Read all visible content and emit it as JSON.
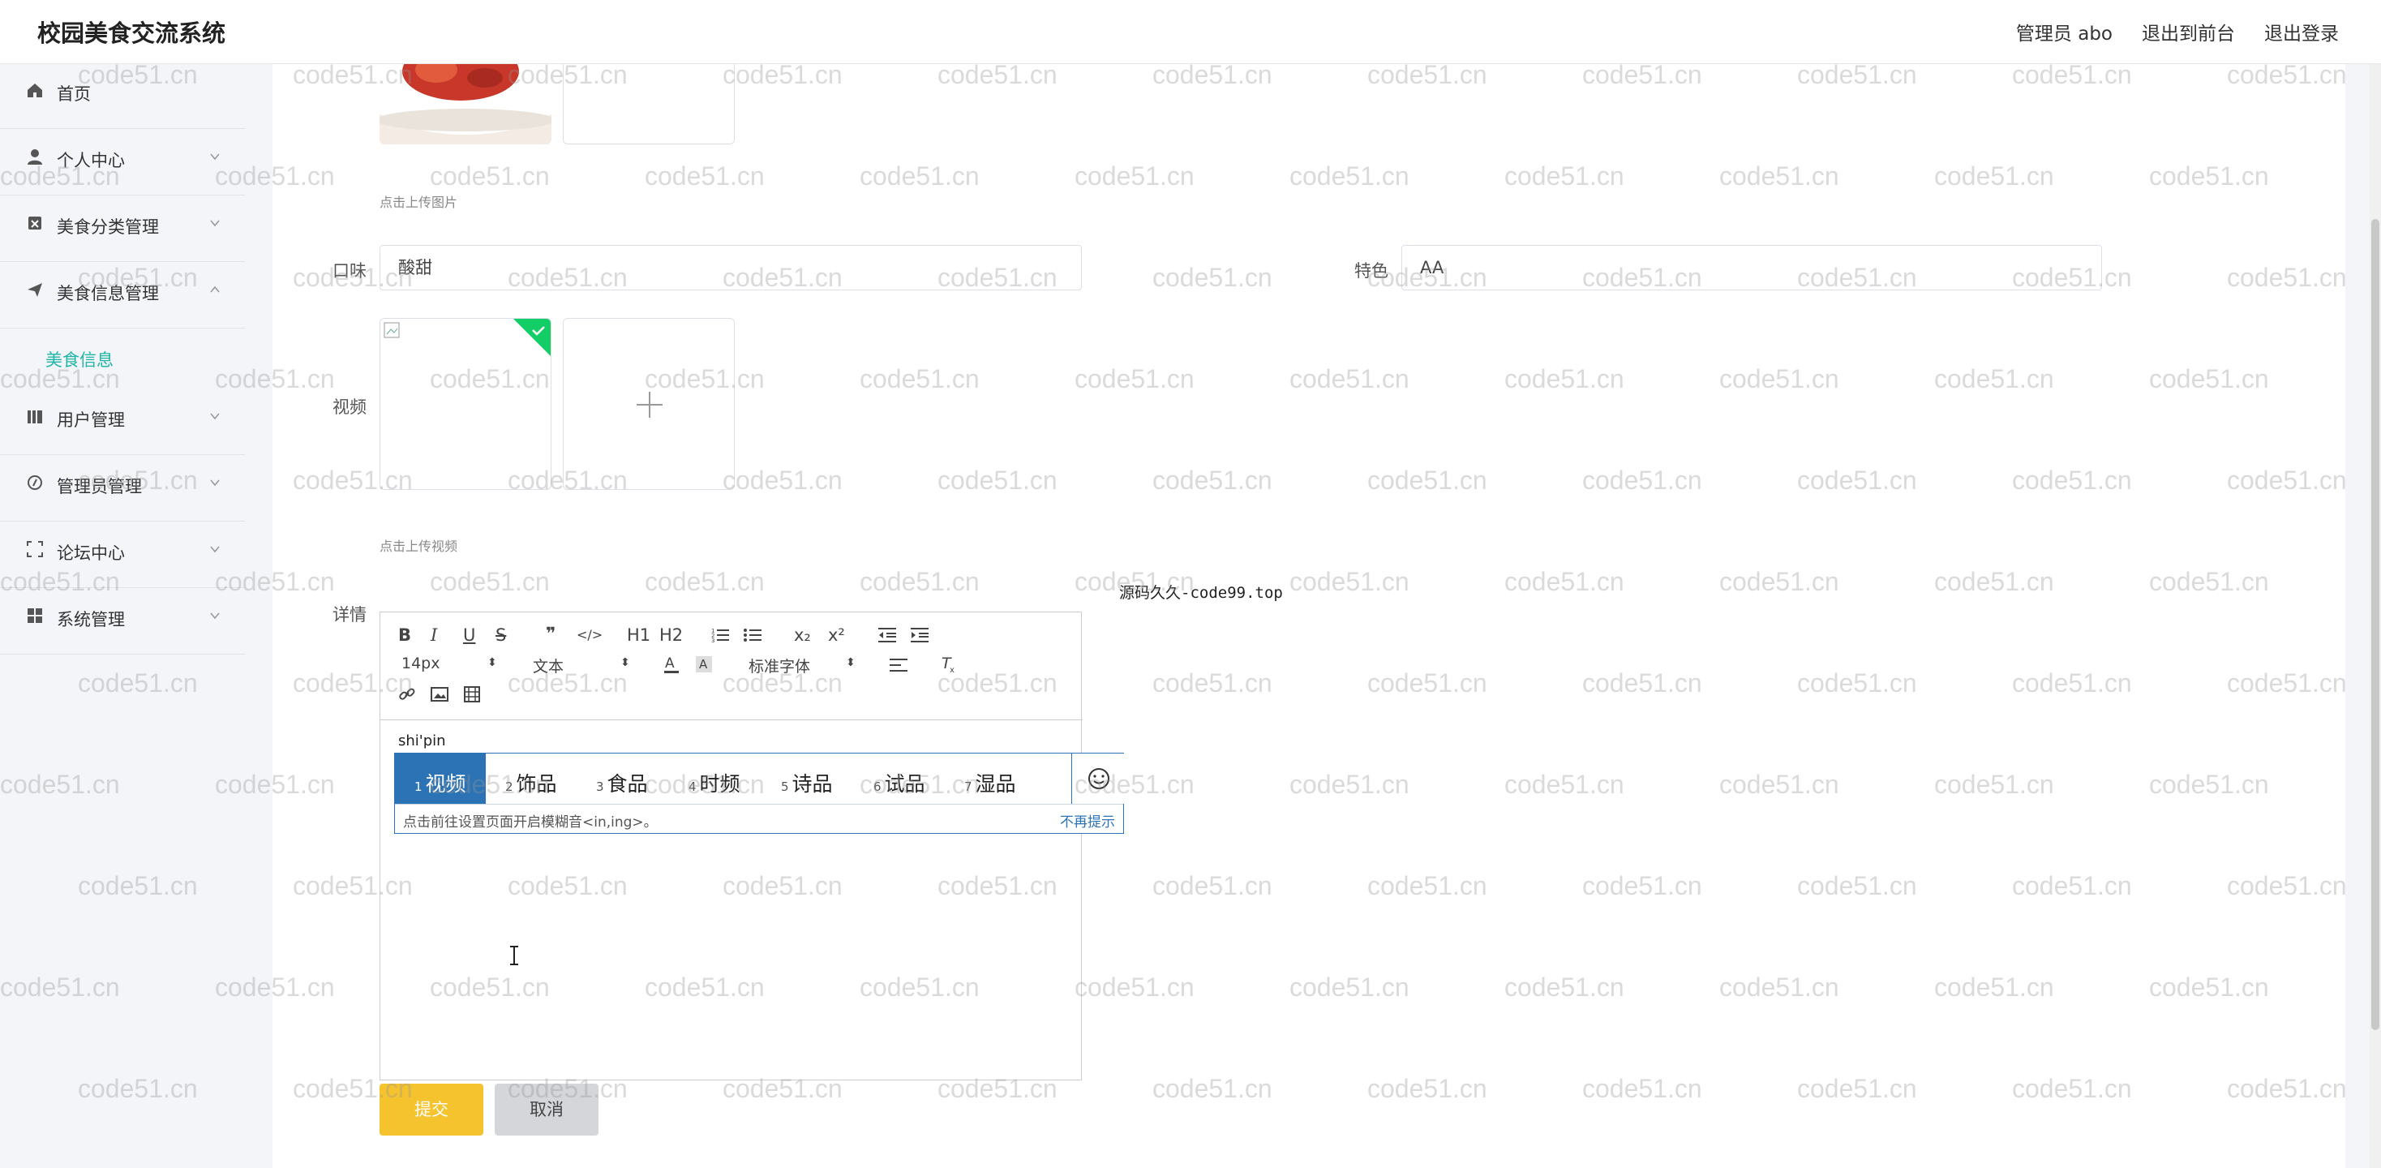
{
  "header": {
    "app_title": "校园美食交流系统",
    "user_label": "管理员 abo",
    "to_frontend": "退出到前台",
    "logout": "退出登录"
  },
  "sidebar": {
    "items": [
      {
        "label": "首页",
        "icon": "home-icon"
      },
      {
        "label": "个人中心",
        "icon": "user-icon"
      },
      {
        "label": "美食分类管理",
        "icon": "category-icon"
      },
      {
        "label": "美食信息管理",
        "icon": "send-icon"
      },
      {
        "label": "用户管理",
        "icon": "bars-icon"
      },
      {
        "label": "管理员管理",
        "icon": "compass-icon"
      },
      {
        "label": "论坛中心",
        "icon": "frame-icon"
      },
      {
        "label": "系统管理",
        "icon": "grid-icon"
      }
    ],
    "active_sub": "美食信息"
  },
  "form": {
    "image_hint": "点击上传图片",
    "taste_label": "口味",
    "taste_value": "酸甜",
    "feature_label": "特色",
    "feature_value": "AA",
    "video_label": "视频",
    "video_hint": "点击上传视频",
    "detail_label": "详情",
    "submit": "提交",
    "cancel": "取消"
  },
  "editor": {
    "font_size": "14px",
    "header_select": "文本",
    "font_family": "标准字体",
    "content": "shi'pin",
    "toolbar_buttons": [
      "B",
      "I",
      "U",
      "S",
      "❞",
      "</>",
      "H1",
      "H2",
      "ordered-list",
      "bullet-list",
      "x₂",
      "x²",
      "outdent",
      "indent",
      "font-color",
      "background",
      "align",
      "clean",
      "link",
      "image",
      "video"
    ]
  },
  "ime": {
    "candidates": [
      "视频",
      "饰品",
      "食品",
      "时频",
      "诗品",
      "试品",
      "湿品"
    ],
    "tip": "点击前往设置页面开启模糊音<in,ing>。",
    "dismiss": "不再提示"
  },
  "overlay_text": "源码久久-code99.top",
  "watermark": "code51.cn",
  "colors": {
    "accent": "#1fb5a7",
    "submit": "#f5c32e",
    "ime_selected": "#2b73b5",
    "success_badge": "#13ce66"
  }
}
